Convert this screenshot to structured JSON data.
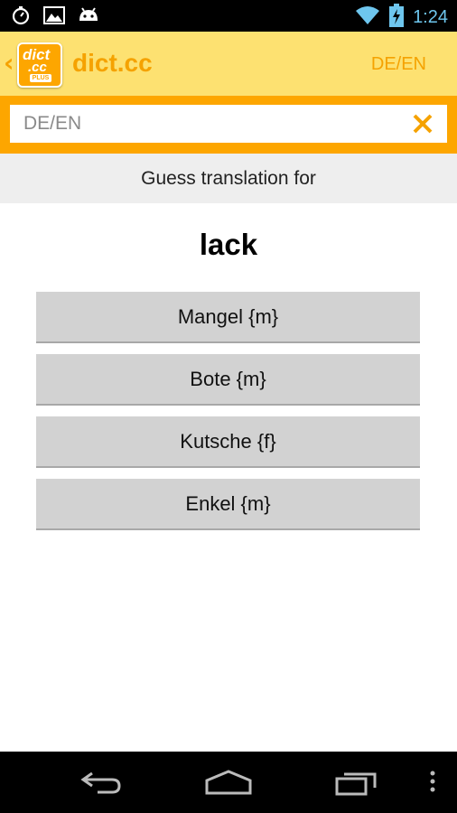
{
  "status_bar": {
    "time": "1:24",
    "icons": [
      "stopwatch-icon",
      "image-icon",
      "android-icon",
      "wifi-icon",
      "battery-charging-icon"
    ]
  },
  "action_bar": {
    "title": "dict.cc",
    "logo_text_top": "dict",
    "logo_text_bottom": ".cc",
    "logo_badge": "PLUS",
    "language_pair": "DE/EN"
  },
  "search": {
    "placeholder": "DE/EN",
    "value": ""
  },
  "quiz": {
    "header": "Guess translation for",
    "word": "lack",
    "options": [
      "Mangel {m}",
      "Bote {m}",
      "Kutsche {f}",
      "Enkel {m}"
    ]
  },
  "colors": {
    "accent": "#f5a200",
    "action_bar_bg": "#fde171",
    "status_time": "#6ec6ee"
  }
}
